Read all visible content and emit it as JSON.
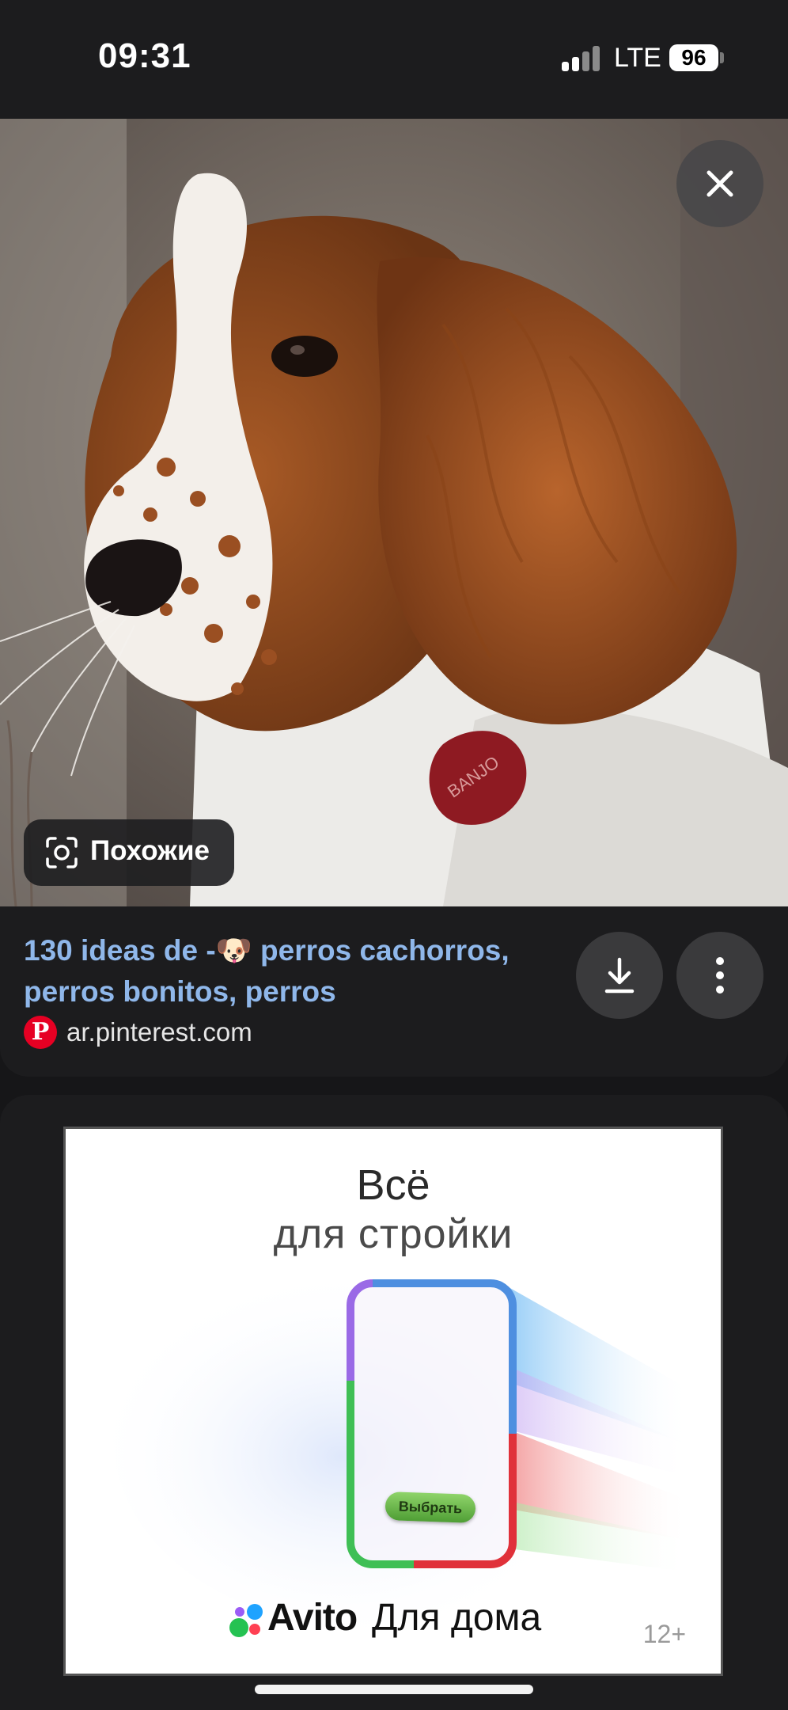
{
  "status_bar": {
    "time": "09:31",
    "network": "LTE",
    "battery": "96"
  },
  "viewer": {
    "similar_label": "Похожие",
    "close_icon": "close-icon",
    "camera_icon": "camera-lens-icon"
  },
  "result": {
    "title": "130 ideas de -🐶 perros cachorros, perros bonitos, perros",
    "source_domain": "ar.pinterest.com",
    "source_icon": "pinterest-icon",
    "download_icon": "download-icon",
    "more_icon": "more-vertical-icon"
  },
  "ad": {
    "headline_line1": "Всё",
    "headline_line2": "для стройки",
    "cta_label": "Выбрать",
    "brand": "Avito",
    "brand_sub": "Для дома",
    "age_rating": "12+"
  },
  "colors": {
    "title_link": "#8fb7ea",
    "pinterest_red": "#e60023",
    "card_bg": "#1c1c1e"
  }
}
